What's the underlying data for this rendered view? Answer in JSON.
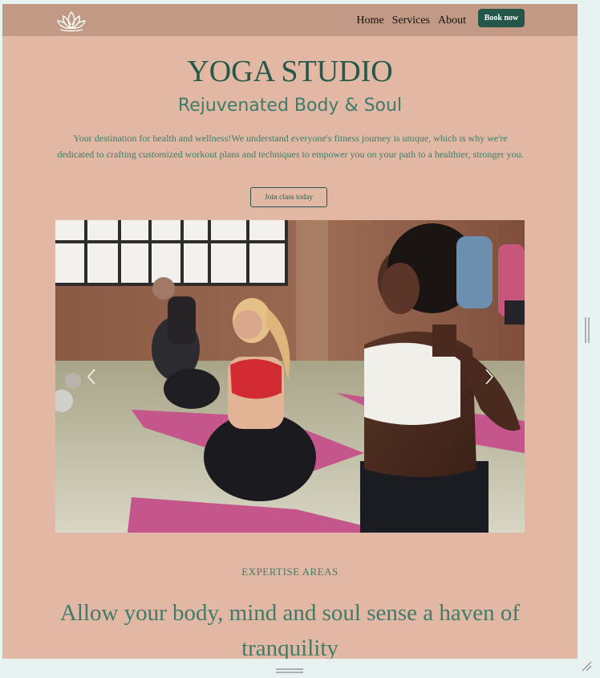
{
  "nav": {
    "logo_icon": "lotus-icon",
    "links": [
      {
        "label": "Home"
      },
      {
        "label": "Services"
      },
      {
        "label": "About"
      }
    ],
    "cta_label": "Book now"
  },
  "hero": {
    "title": "YOGA STUDIO",
    "subtitle": "Rejuvenated Body & Soul",
    "description": "Your destination for health and wellness!We understand everyone's fitness journey is unique, which is why we're dedicated to crafting customized workout plans and techniques to empower you on your path to a healthier, stronger you.",
    "button_label": "Join class today"
  },
  "carousel": {
    "prev_icon": "chevron-left-icon",
    "next_icon": "chevron-right-icon"
  },
  "expertise": {
    "label": "EXPERTISE AREAS",
    "headline": "Allow your body, mind and soul sense a haven of tranquility"
  },
  "colors": {
    "page_bg": "#e2b8a4",
    "nav_bg": "#c29985",
    "accent": "#23574a",
    "text_teal": "#3e7b6b"
  }
}
